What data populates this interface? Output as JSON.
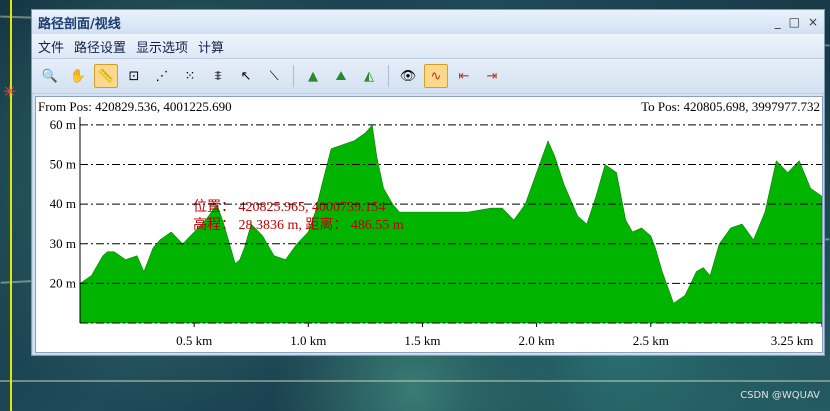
{
  "window": {
    "title": "路径剖面/视线",
    "controls": [
      "_",
      "□",
      "×"
    ]
  },
  "menu": [
    "文件",
    "路径设置",
    "显示选项",
    "计算"
  ],
  "toolbar_icons": [
    "zoom-icon",
    "hand-pan-icon",
    "ruler-icon",
    "grid-select-icon",
    "point-select-icon",
    "distribute-icon",
    "align-icon",
    "pointer-icon",
    "line-icon",
    "profile-icon",
    "terrain-icon",
    "visibility-icon",
    "eye-icon",
    "curve-icon",
    "back-icon",
    "forward-icon"
  ],
  "profile": {
    "from_pos": "From Pos: 420829.536, 4001225.690",
    "to_pos": "To Pos: 420805.698, 3997977.732",
    "annotation_line1": "位置： 420825.965, 4000739.154",
    "annotation_line2": "高程： 28.3836 m, 距离： 486.55 m"
  },
  "chart_data": {
    "type": "area",
    "ylabel_ticks": [
      "20 m",
      "30 m",
      "40 m",
      "50 m",
      "60 m"
    ],
    "yticks": [
      20,
      30,
      40,
      50,
      60
    ],
    "xtick_labels": [
      "0.5 km",
      "1.0 km",
      "1.5 km",
      "2.0 km",
      "2.5 km",
      "3.25 km"
    ],
    "xticks": [
      0.5,
      1.0,
      1.5,
      2.0,
      2.5,
      3.25
    ],
    "xlim": [
      0,
      3.25
    ],
    "ylim": [
      10,
      62
    ],
    "fill_color": "#00b400",
    "x": [
      0,
      0.05,
      0.1,
      0.12,
      0.15,
      0.2,
      0.25,
      0.28,
      0.32,
      0.35,
      0.4,
      0.45,
      0.5,
      0.55,
      0.6,
      0.63,
      0.66,
      0.68,
      0.7,
      0.72,
      0.75,
      0.8,
      0.85,
      0.9,
      0.95,
      1.0,
      1.03,
      1.06,
      1.1,
      1.15,
      1.2,
      1.25,
      1.28,
      1.3,
      1.33,
      1.37,
      1.4,
      1.45,
      1.5,
      1.6,
      1.7,
      1.8,
      1.85,
      1.9,
      1.95,
      2.0,
      2.05,
      2.08,
      2.12,
      2.18,
      2.22,
      2.26,
      2.3,
      2.35,
      2.39,
      2.42,
      2.46,
      2.5,
      2.52,
      2.55,
      2.6,
      2.65,
      2.7,
      2.73,
      2.76,
      2.8,
      2.85,
      2.9,
      2.95,
      3.0,
      3.05,
      3.1,
      3.15,
      3.2,
      3.25
    ],
    "y": [
      20,
      22,
      27,
      28,
      28,
      26,
      27,
      23,
      29,
      31,
      33,
      30,
      33,
      36,
      40,
      35,
      29,
      25,
      26,
      29,
      35,
      32,
      27,
      26,
      30,
      33,
      38,
      45,
      54,
      55,
      56,
      58,
      60,
      52,
      44,
      40,
      38,
      38,
      38,
      38,
      38,
      39,
      39,
      36,
      40,
      48,
      56,
      52,
      45,
      37,
      35,
      42,
      50,
      48,
      36,
      33,
      34,
      32,
      29,
      23,
      15,
      17,
      23,
      24,
      22,
      30,
      34,
      35,
      31,
      38,
      51,
      48,
      51,
      44,
      42
    ]
  }
}
